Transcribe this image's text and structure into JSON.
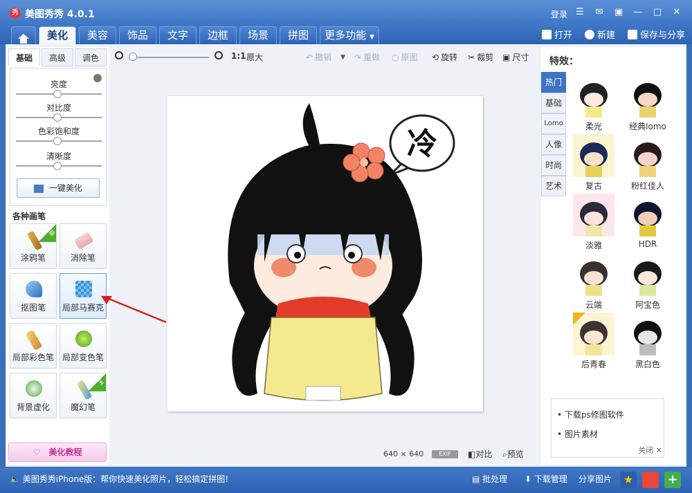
{
  "app": {
    "logo_text": "秀",
    "title": "美图秀秀 4.0.1",
    "login": "登录"
  },
  "window_controls": [
    {
      "name": "menu-icon",
      "glyph": "☰"
    },
    {
      "name": "feedback-icon",
      "glyph": "✉"
    },
    {
      "name": "skin-icon",
      "glyph": "▣"
    },
    {
      "name": "minimize-icon",
      "glyph": "—"
    },
    {
      "name": "maximize-icon",
      "glyph": "□"
    },
    {
      "name": "close-icon",
      "glyph": "✕"
    }
  ],
  "tabs": [
    {
      "label": "美化",
      "active": true
    },
    {
      "label": "美容",
      "active": false
    },
    {
      "label": "饰品",
      "active": false
    },
    {
      "label": "文字",
      "active": false
    },
    {
      "label": "边框",
      "active": false
    },
    {
      "label": "场景",
      "active": false
    },
    {
      "label": "拼图",
      "active": false
    },
    {
      "label": "更多功能",
      "active": false
    }
  ],
  "top_actions": {
    "open": "打开",
    "new": "新建",
    "save_share": "保存与分享"
  },
  "left_panel": {
    "subtabs": [
      "基础",
      "高级",
      "调色"
    ],
    "sliders": [
      "亮度",
      "对比度",
      "色彩饱和度",
      "清晰度"
    ],
    "onekey": "一键美化",
    "section_title": "各种画笔",
    "brushes": [
      {
        "label": "涂鸦笔",
        "badge": "升级"
      },
      {
        "label": "消除笔",
        "badge": ""
      },
      {
        "label": "抠图笔",
        "badge": ""
      },
      {
        "label": "局部马赛克",
        "badge": ""
      },
      {
        "label": "局部彩色笔",
        "badge": ""
      },
      {
        "label": "局部变色笔",
        "badge": ""
      },
      {
        "label": "背景虚化",
        "badge": ""
      },
      {
        "label": "魔幻笔",
        "badge": "new"
      }
    ],
    "tutorial": "美化教程"
  },
  "canvas_toolbar": {
    "zoom_ratio": "1:1",
    "original_size": "原大",
    "undo": "撤销",
    "redo": "重做",
    "original": "原图",
    "rotate": "旋转",
    "crop": "裁剪",
    "size": "尺寸"
  },
  "canvas": {
    "bubble_text": "冷",
    "dimensions": "640 × 640",
    "exif": "EXIF",
    "compare": "对比",
    "preview": "预览"
  },
  "effects": {
    "title": "特效：",
    "categories": [
      {
        "label": "热门",
        "active": true
      },
      {
        "label": "基础",
        "active": false
      },
      {
        "label": "Lomo",
        "active": false
      },
      {
        "label": "人像",
        "active": false
      },
      {
        "label": "时尚",
        "active": false
      },
      {
        "label": "艺术",
        "active": false
      }
    ],
    "items": [
      "柔光",
      "经典lomo",
      "复古",
      "粉红佳人",
      "淡雅",
      "HDR",
      "云端",
      "阿宝色",
      "后青春",
      "黑白色"
    ],
    "news": [
      "下载ps修图软件",
      "图片素材"
    ],
    "news_close": "关闭"
  },
  "statusbar": {
    "message": "美图秀秀iPhone版：帮你快速美化照片，轻松搞定拼图!",
    "batch": "批处理",
    "download_manage": "下载管理",
    "share_image": "分享图片"
  }
}
